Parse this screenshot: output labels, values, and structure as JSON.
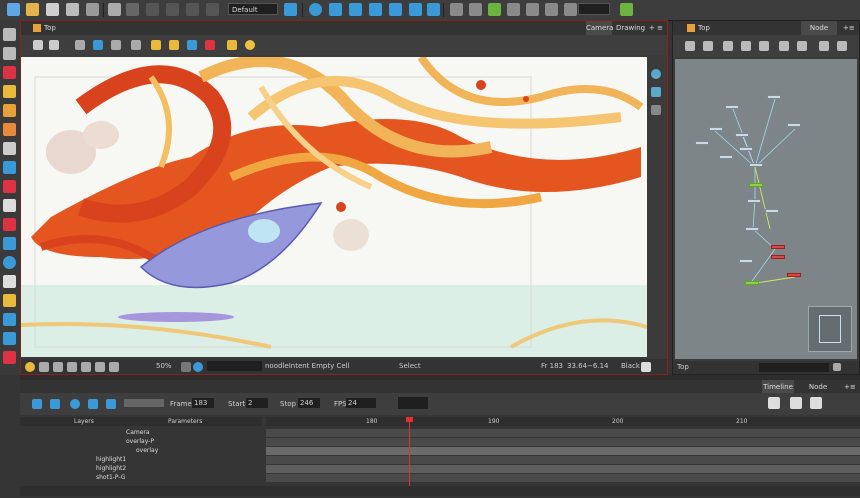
{
  "toolbar": {
    "workspace": "Default",
    "colors": {
      "accent": "#2f8fd8",
      "yellow": "#e9b93b",
      "green": "#6db33f"
    }
  },
  "camera_view": {
    "title": "Top",
    "tabs": [
      "Camera",
      "Drawing"
    ],
    "status": {
      "zoom": "50%",
      "cell": "noodleIntent Empty Cell",
      "tool": "Select",
      "frame": "Fr 183",
      "coords": "33.64−6.14",
      "bg": "Black"
    }
  },
  "node_view": {
    "title": "Top",
    "tab": "Node View",
    "footer": "Top"
  },
  "timeline": {
    "tabs": [
      "Timeline",
      "Node Library"
    ],
    "frame_label": "Frame",
    "frame_value": "183",
    "start_label": "Start",
    "start_value": "2",
    "stop_label": "Stop",
    "stop_value": "246",
    "fps_label": "FPS",
    "fps_value": "24",
    "layers_label": "Layers",
    "params_label": "Parameters",
    "ruler": [
      "180",
      "190",
      "200",
      "210"
    ],
    "layers": [
      "Camera",
      "overlay-P",
      "overlay",
      "highlight1",
      "highlight2",
      "shot1-P-G"
    ]
  }
}
